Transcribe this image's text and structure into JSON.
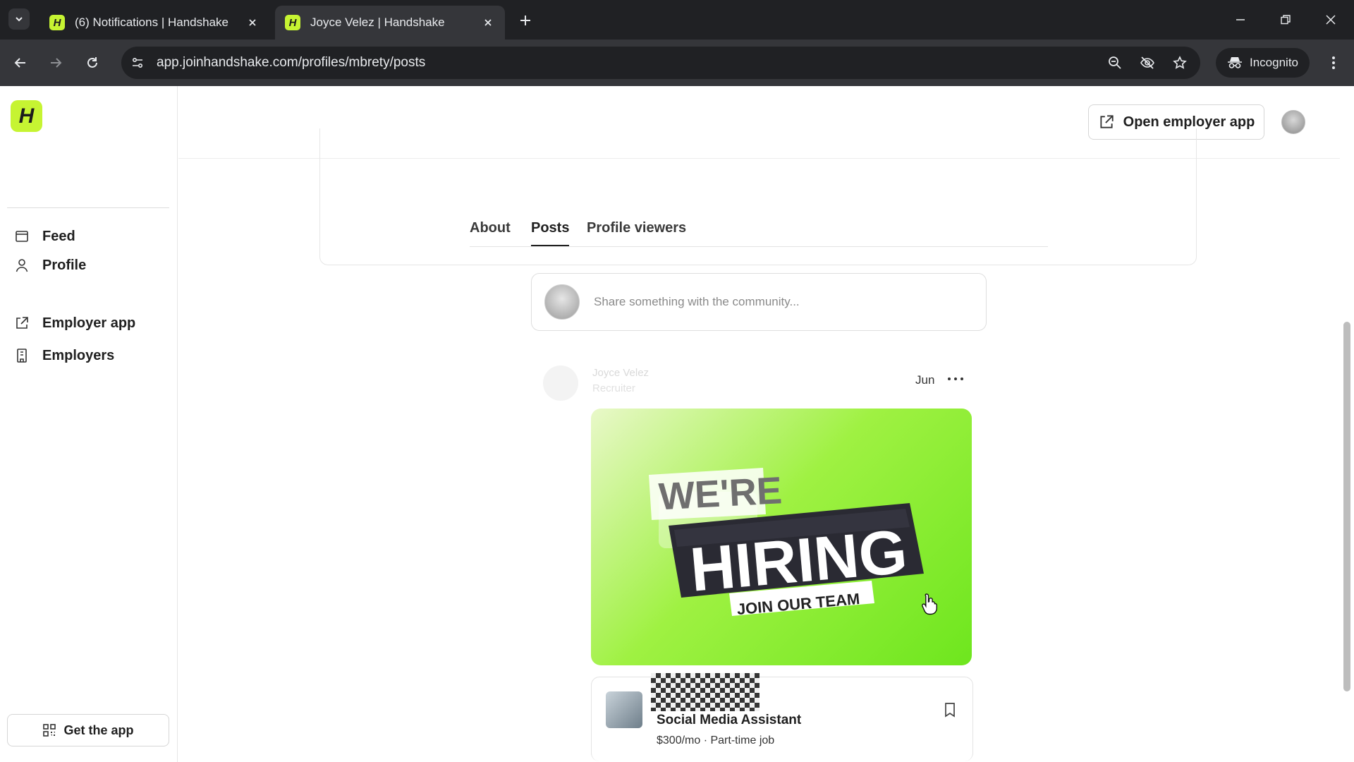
{
  "browser": {
    "tabs": [
      {
        "title": "(6) Notifications | Handshake",
        "favicon": "H",
        "active": false
      },
      {
        "title": "Joyce Velez | Handshake",
        "favicon": "H",
        "active": true
      }
    ],
    "url": "app.joinhandshake.com/profiles/mbrety/posts",
    "incognito_label": "Incognito"
  },
  "sidebar": {
    "logo": "H",
    "items": [
      {
        "label": "Feed",
        "icon": "feed-icon"
      },
      {
        "label": "Profile",
        "icon": "person-icon"
      },
      {
        "label": "Employer app",
        "icon": "external-link-icon"
      },
      {
        "label": "Employers",
        "icon": "building-icon"
      }
    ],
    "get_app_label": "Get the app"
  },
  "header": {
    "open_employer_label": "Open employer app"
  },
  "profile_tabs": [
    {
      "label": "About",
      "active": false
    },
    {
      "label": "Posts",
      "active": true
    },
    {
      "label": "Profile viewers",
      "active": false
    }
  ],
  "composer": {
    "placeholder": "Share something with the community..."
  },
  "post": {
    "author": "Joyce Velez",
    "subtitle": "Recruiter",
    "date": "Jun",
    "image": {
      "line1": "WE'RE",
      "line2": "HIRING",
      "line3": "JOIN OUR TEAM"
    },
    "job": {
      "title": "Social Media Assistant",
      "meta": "$300/mo · Part-time job"
    }
  },
  "colors": {
    "brand": "#c6f432",
    "chrome_dark": "#202124",
    "chrome_mid": "#35363a"
  }
}
